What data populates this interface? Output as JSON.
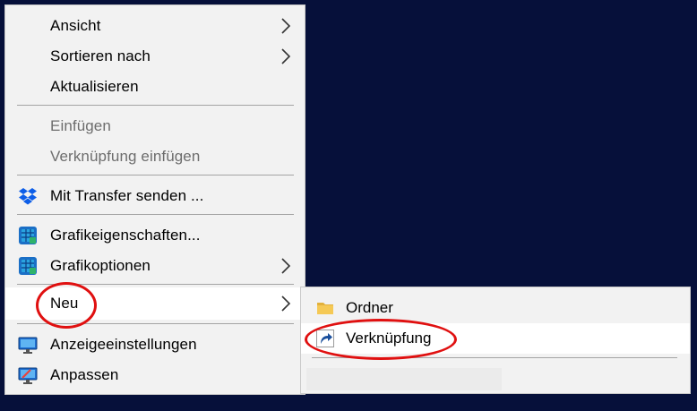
{
  "menu": {
    "items": [
      {
        "label": "Ansicht",
        "icon": "",
        "has_submenu": true
      },
      {
        "label": "Sortieren nach",
        "icon": "",
        "has_submenu": true
      },
      {
        "label": "Aktualisieren",
        "icon": "",
        "has_submenu": false
      },
      {
        "label": "Einfügen",
        "icon": "",
        "has_submenu": false,
        "disabled": true
      },
      {
        "label": "Verknüpfung einfügen",
        "icon": "",
        "has_submenu": false,
        "disabled": true
      },
      {
        "label": "Mit Transfer senden ...",
        "icon": "dropbox-icon",
        "has_submenu": false
      },
      {
        "label": "Grafikeigenschaften...",
        "icon": "intel-graphics-icon",
        "has_submenu": false
      },
      {
        "label": "Grafikoptionen",
        "icon": "intel-graphics-icon",
        "has_submenu": true
      },
      {
        "label": "Neu",
        "icon": "",
        "has_submenu": true,
        "highlighted": true
      },
      {
        "label": "Anzeigeeinstellungen",
        "icon": "display-settings-icon",
        "has_submenu": false
      },
      {
        "label": "Anpassen",
        "icon": "personalize-icon",
        "has_submenu": false
      }
    ]
  },
  "submenu": {
    "items": [
      {
        "label": "Ordner",
        "icon": "folder-icon"
      },
      {
        "label": "Verknüpfung",
        "icon": "shortcut-icon",
        "highlighted": true
      }
    ]
  },
  "colors": {
    "desktop": "#06103a",
    "menu_bg": "#f2f2f2",
    "highlight": "#ffffff",
    "disabled_text": "#6d6d6d",
    "annotation": "#e01010"
  }
}
